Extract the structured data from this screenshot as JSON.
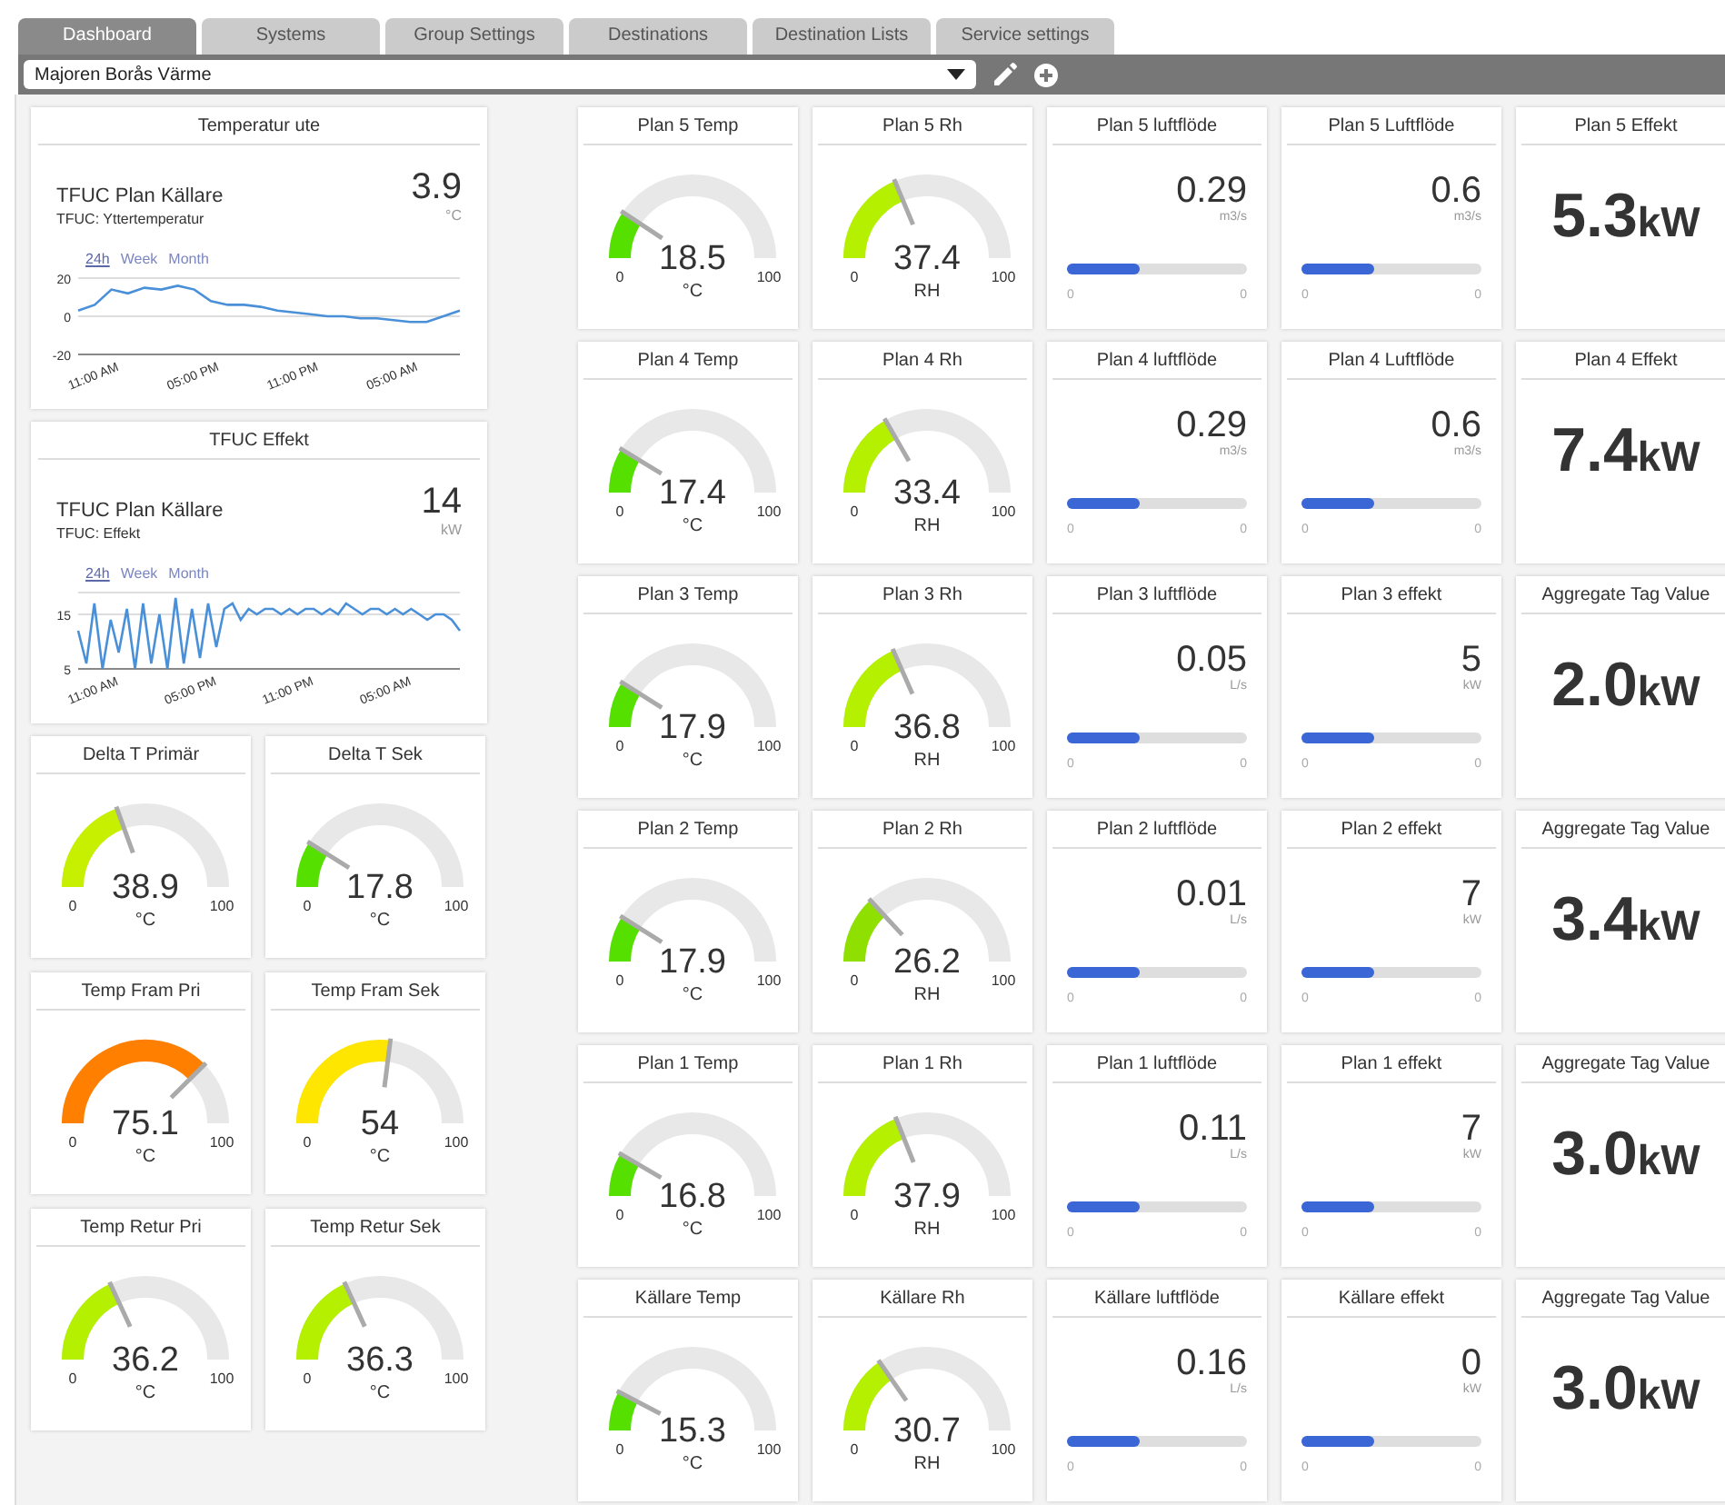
{
  "tabs": [
    {
      "label": "Dashboard",
      "selected": true
    },
    {
      "label": "Systems",
      "selected": false
    },
    {
      "label": "Group Settings",
      "selected": false
    },
    {
      "label": "Destinations",
      "selected": false
    },
    {
      "label": "Destination Lists",
      "selected": false
    },
    {
      "label": "Service settings",
      "selected": false
    }
  ],
  "toolbar": {
    "site_select": {
      "value": "Majoren Borås Värme"
    }
  },
  "left_panel": {
    "chart_cards": [
      {
        "title": "Temperatur ute",
        "name": "TFUC Plan Källare",
        "subtitle": "TFUC: Yttertemperatur",
        "value": "3.9",
        "unit": "°C",
        "ranges": [
          {
            "label": "24h",
            "selected": true
          },
          {
            "label": "Week",
            "selected": false
          },
          {
            "label": "Month",
            "selected": false
          }
        ],
        "chart_data": {
          "type": "line",
          "categories": [
            null,
            "11:00 AM",
            null,
            null,
            null,
            null,
            null,
            "05:00 PM",
            null,
            null,
            null,
            null,
            null,
            "11:00 PM",
            null,
            null,
            null,
            null,
            null,
            "05:00 AM",
            null,
            null,
            null,
            null
          ],
          "series": [
            {
              "color": "#4a90d9",
              "values": [
                3,
                6,
                14,
                12,
                15,
                14,
                16,
                14,
                8,
                6,
                6,
                5,
                3,
                2,
                1,
                0,
                0,
                -1,
                -1,
                -2,
                -3,
                -3,
                0,
                3
              ]
            }
          ],
          "ylim": [
            -20,
            20
          ],
          "yticks": [
            20,
            0,
            -20
          ]
        }
      },
      {
        "title": "TFUC Effekt",
        "name": "TFUC Plan Källare",
        "subtitle": "TFUC: Effekt",
        "value": "14",
        "unit": "kW",
        "ranges": [
          {
            "label": "24h",
            "selected": true
          },
          {
            "label": "Week",
            "selected": false
          },
          {
            "label": "Month",
            "selected": false
          }
        ],
        "chart_data": {
          "type": "line",
          "categories": [
            null,
            null,
            "11:00 AM",
            null,
            null,
            null,
            null,
            null,
            null,
            null,
            null,
            null,
            null,
            null,
            "05:00 PM",
            null,
            null,
            null,
            null,
            null,
            null,
            null,
            null,
            null,
            null,
            null,
            "11:00 PM",
            null,
            null,
            null,
            null,
            null,
            null,
            null,
            null,
            null,
            null,
            null,
            "05:00 AM",
            null,
            null,
            null,
            null,
            null,
            null,
            null,
            null,
            null
          ],
          "series": [
            {
              "color": "#4a90d9",
              "values": [
                12,
                6,
                17,
                5,
                14,
                8,
                16,
                5,
                17,
                6,
                15,
                5,
                18,
                6,
                16,
                7,
                17,
                9,
                16,
                17,
                14,
                16,
                15,
                16,
                16,
                15,
                16,
                15,
                16,
                16,
                15,
                16,
                15,
                17,
                16,
                15,
                16,
                16,
                15,
                16,
                15,
                16,
                15,
                14,
                15,
                15,
                14,
                12
              ]
            }
          ],
          "ylim": [
            5,
            19
          ],
          "yticks": [
            15,
            5
          ]
        }
      }
    ],
    "gauge_cards": [
      {
        "title": "Delta T Primär",
        "value": "38.9",
        "unit": "°C",
        "min": "0",
        "max": "100",
        "color": "#c6f000"
      },
      {
        "title": "Delta T Sek",
        "value": "17.8",
        "unit": "°C",
        "min": "0",
        "max": "100",
        "color": "#55e000"
      },
      {
        "title": "Temp Fram Pri",
        "value": "75.1",
        "unit": "°C",
        "min": "0",
        "max": "100",
        "color": "#ff7f00"
      },
      {
        "title": "Temp Fram Sek",
        "value": "54",
        "unit": "°C",
        "min": "0",
        "max": "100",
        "color": "#ffe600"
      },
      {
        "title": "Temp Retur Pri",
        "value": "36.2",
        "unit": "°C",
        "min": "0",
        "max": "100",
        "color": "#b4f000"
      },
      {
        "title": "Temp Retur Sek",
        "value": "36.3",
        "unit": "°C",
        "min": "0",
        "max": "100",
        "color": "#b4f000"
      }
    ]
  },
  "grid": {
    "cards": [
      {
        "kind": "gauge",
        "title": "Plan 5 Temp",
        "value": "18.5",
        "unit": "°C",
        "min": "0",
        "max": "100",
        "color": "#55e000"
      },
      {
        "kind": "gauge",
        "title": "Plan 5 Rh",
        "value": "37.4",
        "unit": "RH",
        "min": "0",
        "max": "100",
        "color": "#b4f000"
      },
      {
        "kind": "bar",
        "title": "Plan 5 luftflöde",
        "value": "0.29",
        "unit": "m3/s",
        "min": "0",
        "max": "0",
        "level": 0.4
      },
      {
        "kind": "bar",
        "title": "Plan 5 Luftflöde",
        "value": "0.6",
        "unit": "m3/s",
        "min": "0",
        "max": "0",
        "level": 0.4
      },
      {
        "kind": "big",
        "title": "Plan 5 Effekt",
        "value": "5.3",
        "unit": "kW"
      },
      {
        "kind": "gauge",
        "title": "Plan 4 Temp",
        "value": "17.4",
        "unit": "°C",
        "min": "0",
        "max": "100",
        "color": "#55e000"
      },
      {
        "kind": "gauge",
        "title": "Plan 4 Rh",
        "value": "33.4",
        "unit": "RH",
        "min": "0",
        "max": "100",
        "color": "#b4f000"
      },
      {
        "kind": "bar",
        "title": "Plan 4 luftflöde",
        "value": "0.29",
        "unit": "m3/s",
        "min": "0",
        "max": "0",
        "level": 0.4
      },
      {
        "kind": "bar",
        "title": "Plan 4 Luftflöde",
        "value": "0.6",
        "unit": "m3/s",
        "min": "0",
        "max": "0",
        "level": 0.4
      },
      {
        "kind": "big",
        "title": "Plan 4 Effekt",
        "value": "7.4",
        "unit": "kW"
      },
      {
        "kind": "gauge",
        "title": "Plan 3 Temp",
        "value": "17.9",
        "unit": "°C",
        "min": "0",
        "max": "100",
        "color": "#55e000"
      },
      {
        "kind": "gauge",
        "title": "Plan 3 Rh",
        "value": "36.8",
        "unit": "RH",
        "min": "0",
        "max": "100",
        "color": "#b4f000"
      },
      {
        "kind": "bar",
        "title": "Plan 3 luftflöde",
        "value": "0.05",
        "unit": "L/s",
        "min": "0",
        "max": "0",
        "level": 0.4
      },
      {
        "kind": "bar",
        "title": "Plan 3 effekt",
        "value": "5",
        "unit": "kW",
        "min": "0",
        "max": "0",
        "level": 0.4
      },
      {
        "kind": "big",
        "title": "Aggregate Tag Value",
        "value": "2.0",
        "unit": "kW"
      },
      {
        "kind": "gauge",
        "title": "Plan 2 Temp",
        "value": "17.9",
        "unit": "°C",
        "min": "0",
        "max": "100",
        "color": "#55e000"
      },
      {
        "kind": "gauge",
        "title": "Plan 2 Rh",
        "value": "26.2",
        "unit": "RH",
        "min": "0",
        "max": "100",
        "color": "#8fe000"
      },
      {
        "kind": "bar",
        "title": "Plan 2 luftflöde",
        "value": "0.01",
        "unit": "L/s",
        "min": "0",
        "max": "0",
        "level": 0.4
      },
      {
        "kind": "bar",
        "title": "Plan 2 effekt",
        "value": "7",
        "unit": "kW",
        "min": "0",
        "max": "0",
        "level": 0.4
      },
      {
        "kind": "big",
        "title": "Aggregate Tag Value",
        "value": "3.4",
        "unit": "kW"
      },
      {
        "kind": "gauge",
        "title": "Plan 1 Temp",
        "value": "16.8",
        "unit": "°C",
        "min": "0",
        "max": "100",
        "color": "#55e000"
      },
      {
        "kind": "gauge",
        "title": "Plan 1 Rh",
        "value": "37.9",
        "unit": "RH",
        "min": "0",
        "max": "100",
        "color": "#b4f000"
      },
      {
        "kind": "bar",
        "title": "Plan 1 luftflöde",
        "value": "0.11",
        "unit": "L/s",
        "min": "0",
        "max": "0",
        "level": 0.4
      },
      {
        "kind": "bar",
        "title": "Plan 1 effekt",
        "value": "7",
        "unit": "kW",
        "min": "0",
        "max": "0",
        "level": 0.4
      },
      {
        "kind": "big",
        "title": "Aggregate Tag Value",
        "value": "3.0",
        "unit": "kW"
      },
      {
        "kind": "gauge",
        "title": "Källare Temp",
        "value": "15.3",
        "unit": "°C",
        "min": "0",
        "max": "100",
        "color": "#55e000"
      },
      {
        "kind": "gauge",
        "title": "Källare Rh",
        "value": "30.7",
        "unit": "RH",
        "min": "0",
        "max": "100",
        "color": "#b4f000"
      },
      {
        "kind": "bar",
        "title": "Källare luftflöde",
        "value": "0.16",
        "unit": "L/s",
        "min": "0",
        "max": "0",
        "level": 0.4
      },
      {
        "kind": "bar",
        "title": "Källare effekt",
        "value": "0",
        "unit": "kW",
        "min": "0",
        "max": "0",
        "level": 0.4
      },
      {
        "kind": "big",
        "title": "Aggregate Tag Value",
        "value": "3.0",
        "unit": "kW"
      }
    ]
  }
}
